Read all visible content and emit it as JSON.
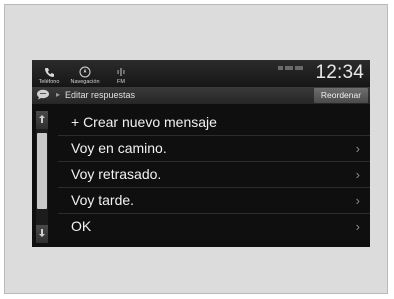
{
  "topbar": {
    "telefono_label": "Teléfono",
    "navegacion_label": "Navegación",
    "fm_label": "FM",
    "clock": "12:34"
  },
  "header": {
    "title": "Editar respuestas",
    "reorder_label": "Reordenar"
  },
  "list": {
    "items": [
      {
        "label": "+ Crear nuevo mensaje",
        "has_chevron": false
      },
      {
        "label": "Voy en camino.",
        "has_chevron": true
      },
      {
        "label": "Voy retrasado.",
        "has_chevron": true
      },
      {
        "label": "Voy tarde.",
        "has_chevron": true
      },
      {
        "label": "OK",
        "has_chevron": true
      }
    ],
    "chevron_glyph": "›"
  },
  "colors": {
    "screen_bg": "#0f0f0f",
    "text": "#f2f2f2",
    "button_bg": "#5a5a5a"
  }
}
